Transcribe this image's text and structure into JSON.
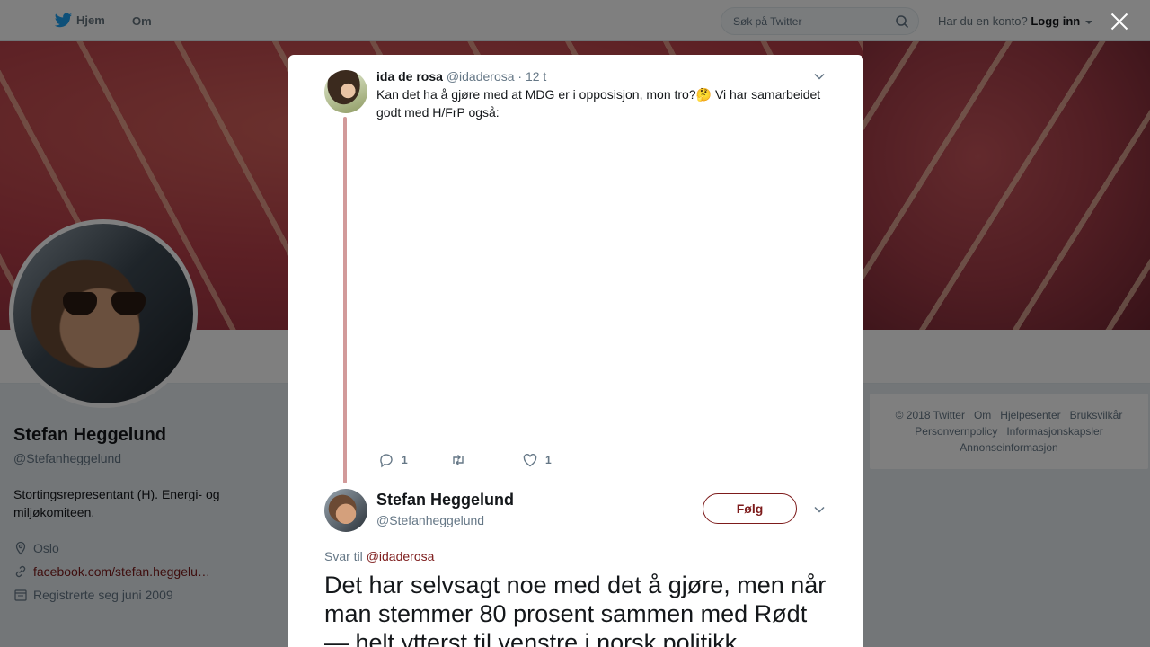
{
  "topbar": {
    "home_label": "Hjem",
    "about_label": "Om",
    "search_placeholder": "Søk på Twitter",
    "account_prompt": "Har du en konto?",
    "login_label": "Logg inn"
  },
  "profile": {
    "name": "Stefan Heggelund",
    "handle": "@Stefanheggelund",
    "bio": "Stortingsrepresentant (H). Energi- og miljøkomiteen.",
    "location": "Oslo",
    "website": "facebook.com/stefan.heggelu…",
    "joined": "Registrerte seg juni 2009"
  },
  "footer": {
    "items": [
      "© 2018 Twitter",
      "Om",
      "Hjelpesenter",
      "Bruksvilkår",
      "Personvernpolicy",
      "Informasjonskapsler",
      "Annonseinformasjon"
    ]
  },
  "modal": {
    "parent_tweet": {
      "name": "ida de rosa",
      "handle": "@idaderosa",
      "time": "· 12 t",
      "text": "Kan det ha å gjøre med at MDG er i opposisjon, mon tro?🤔 Vi har samarbeidet godt med H/FrP også:",
      "reply_count": "1",
      "retweet_count": "",
      "like_count": "1"
    },
    "main_tweet": {
      "name": "Stefan Heggelund",
      "handle": "@Stefanheggelund",
      "follow_label": "Følg",
      "reply_prefix": "Svar til",
      "reply_mention": "@idaderosa",
      "text": "Det har selvsagt noe med det å gjøre, men når man stemmer 80 prosent sammen med Rødt — helt ytterst til venstre i norsk politikk"
    }
  },
  "colors": {
    "accent": "#7d1b1b",
    "thread_line": "#d29a9a",
    "twitter_blue": "#1da1f2"
  },
  "icons": [
    "twitter-bird-icon",
    "search-icon",
    "close-icon",
    "location-icon",
    "link-icon",
    "calendar-icon",
    "chevron-down-icon",
    "reply-icon",
    "retweet-icon",
    "like-icon"
  ]
}
